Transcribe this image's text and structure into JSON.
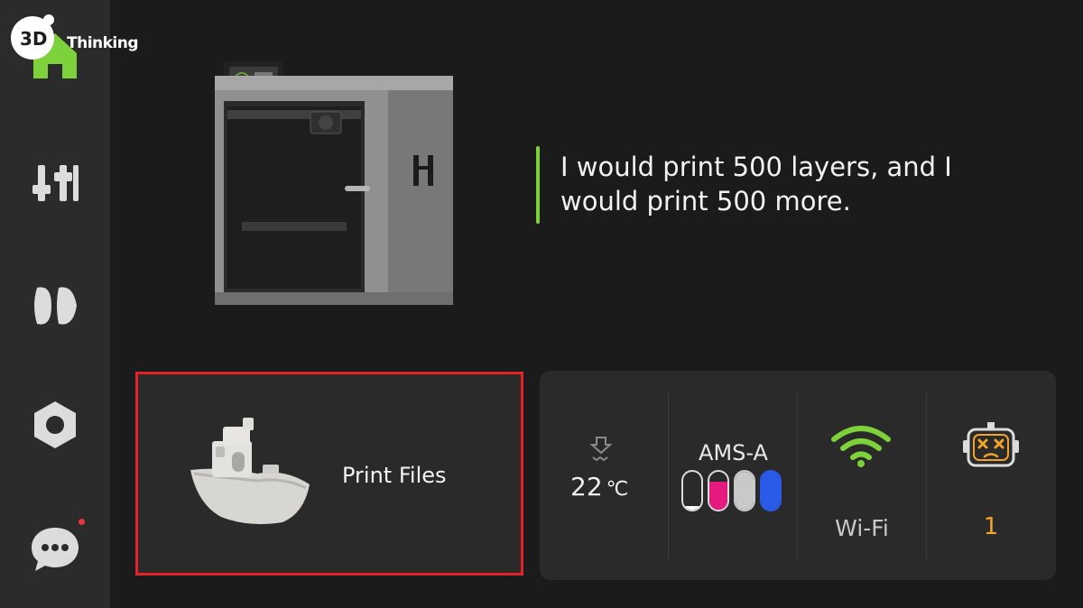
{
  "watermark": {
    "text": "Thinking",
    "mark": "3D"
  },
  "sidebar": {
    "items": [
      {
        "name": "home",
        "icon": "home-icon",
        "active": true
      },
      {
        "name": "controls",
        "icon": "sliders-icon"
      },
      {
        "name": "filament",
        "icon": "filament-icon"
      },
      {
        "name": "settings",
        "icon": "nut-icon"
      },
      {
        "name": "messages",
        "icon": "chat-icon",
        "badge": true
      }
    ]
  },
  "hero": {
    "quote_line1": "I would print 500 layers, and I",
    "quote_line2": "would print 500 more."
  },
  "files_card": {
    "label": "Print Files"
  },
  "status": {
    "temperature": {
      "value": "22",
      "unit": "℃"
    },
    "ams": {
      "label": "AMS-A",
      "spools": [
        {
          "color": "#ffffff",
          "fill": 0.1
        },
        {
          "color": "#e5197e",
          "fill": 0.75
        },
        {
          "color": "#c9c9c9",
          "fill": 1
        },
        {
          "color": "#2a5ae8",
          "fill": 1
        }
      ]
    },
    "wifi": {
      "label": "Wi-Fi"
    },
    "errors": {
      "count": "1"
    }
  },
  "colors": {
    "accent": "#7dd13a",
    "highlight": "#e2232a",
    "warning": "#f2a32a"
  }
}
